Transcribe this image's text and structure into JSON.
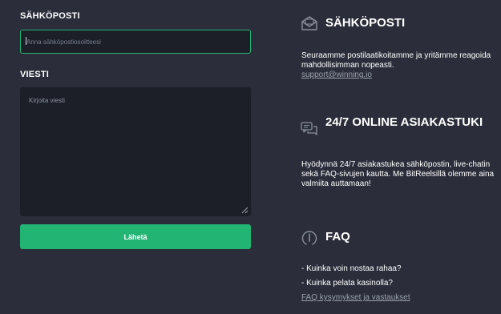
{
  "form": {
    "email_label": "SÄHKÖPOSTI",
    "email_placeholder": "Anna sähköpostiosoitteesi",
    "email_value": "",
    "message_label": "VIESTI",
    "message_placeholder": "Kirjoita viesti",
    "message_value": "",
    "submit_label": "Lähetä"
  },
  "info": {
    "email": {
      "icon": "envelope-icon",
      "title": "SÄHKÖPOSTI",
      "text": "Seuraamme postilaatikoitamme ja yritämme reagoida mahdollisimman nopeasti.",
      "link": "support@winning.io"
    },
    "support": {
      "icon": "chat-bubbles-icon",
      "title": "24/7 ONLINE ASIAKASTUKI",
      "text": "Hyödynnä 24/7 asiakastukea sähköpostin, live-chatin sekä FAQ-sivujen kautta. Me BitReelsillä olemme aina valmiita auttamaan!"
    },
    "faq": {
      "icon": "faq-bulb-icon",
      "title": "FAQ",
      "items": [
        "- Kuinka voin nostaa rahaa?",
        "- Kuinka pelata kasinolla?"
      ],
      "link": "FAQ kysymykset ja vastaukset"
    }
  },
  "colors": {
    "background": "#2b2e3a",
    "input_background": "#1c1f28",
    "accent": "#21b472",
    "link": "#9aa0ad"
  }
}
